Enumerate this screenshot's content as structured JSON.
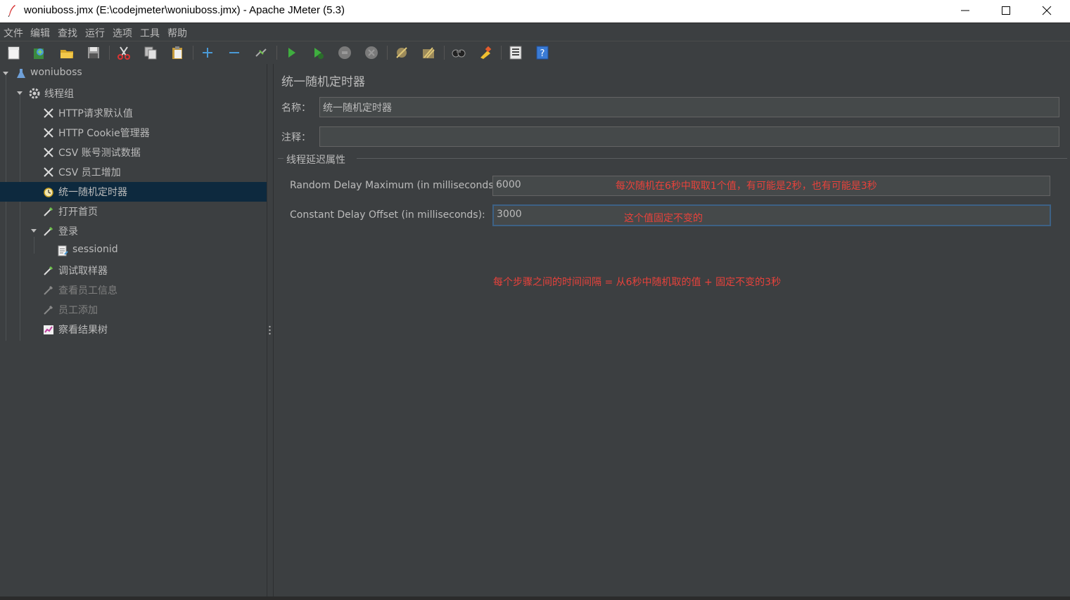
{
  "window": {
    "title": "woniuboss.jmx (E:\\codejmeter\\woniuboss.jmx) - Apache JMeter (5.3)"
  },
  "menu": [
    "文件",
    "编辑",
    "查找",
    "运行",
    "选项",
    "工具",
    "帮助"
  ],
  "toolbar_icons": [
    "new-icon",
    "templates-icon",
    "open-icon",
    "save-icon",
    "cut-icon",
    "copy-icon",
    "paste-icon",
    "expand-icon",
    "collapse-icon",
    "toggle-icon",
    "start-icon",
    "start-no-pause-icon",
    "stop-icon",
    "shutdown-icon",
    "clear-icon",
    "clear-all-icon",
    "search-icon",
    "reset-search-icon",
    "function-helper-icon",
    "help-icon"
  ],
  "tree": {
    "items": [
      {
        "label": "woniuboss",
        "level": 0,
        "type": "test-plan"
      },
      {
        "label": "线程组",
        "level": 1,
        "type": "thread-group"
      },
      {
        "label": "HTTP请求默认值",
        "level": 2,
        "type": "config"
      },
      {
        "label": "HTTP Cookie管理器",
        "level": 2,
        "type": "config"
      },
      {
        "label": "CSV 账号测试数据",
        "level": 2,
        "type": "config"
      },
      {
        "label": "CSV 员工增加",
        "level": 2,
        "type": "config"
      },
      {
        "label": "统一随机定时器",
        "level": 2,
        "type": "timer",
        "selected": true
      },
      {
        "label": "打开首页",
        "level": 2,
        "type": "sampler"
      },
      {
        "label": "登录",
        "level": 2,
        "type": "sampler"
      },
      {
        "label": "sessionid",
        "level": 3,
        "type": "extractor"
      },
      {
        "label": "调试取样器",
        "level": 2,
        "type": "sampler"
      },
      {
        "label": "查看员工信息",
        "level": 2,
        "type": "sampler",
        "disabled": true
      },
      {
        "label": "员工添加",
        "level": 2,
        "type": "sampler",
        "disabled": true
      },
      {
        "label": "察看结果树",
        "level": 2,
        "type": "listener"
      }
    ]
  },
  "panel": {
    "title": "统一随机定时器",
    "name_label": "名称：",
    "name_value": "统一随机定时器",
    "comment_label": "注释：",
    "comment_value": "",
    "group_title": "线程延迟属性",
    "random_delay_label": "Random Delay Maximum (in milliseconds):",
    "random_delay_value": "6000",
    "constant_offset_label": "Constant Delay Offset (in milliseconds):",
    "constant_offset_value": "3000"
  },
  "annotations": {
    "random_note": "每次随机在6秒中取取1个值，有可能是2秒，也有可能是3秒",
    "constant_note": "这个值固定不变的",
    "summary_note": "每个步骤之间的时间间隔 = 从6秒中随机取的值 + 固定不变的3秒"
  },
  "colors": {
    "background": "#3c3f41",
    "selection": "#0d293e",
    "annotation": "#e8423b",
    "field": "#45494a"
  }
}
